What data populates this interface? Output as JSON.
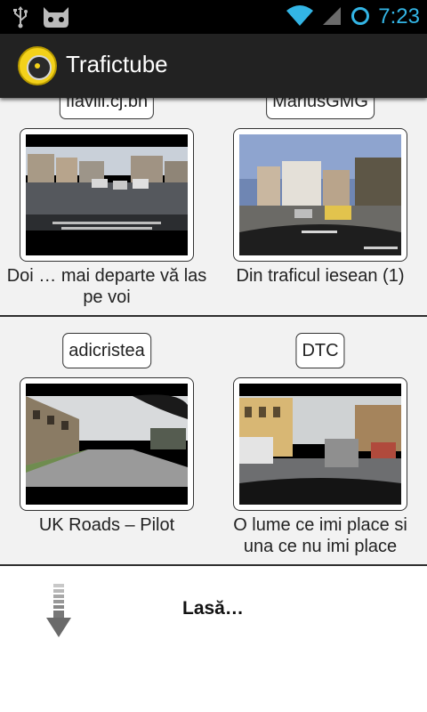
{
  "status_bar": {
    "time": "7:23",
    "icons": [
      "usb-icon",
      "android-debug-icon",
      "wifi-icon",
      "cell-signal-icon",
      "alarm-circle-icon"
    ]
  },
  "app": {
    "title": "Trafictube",
    "icon": "app-logo-icon"
  },
  "videos": [
    {
      "user": "flaviii.cj.bh",
      "title": "Doi … mai departe vă las pe voi"
    },
    {
      "user": "MariusGMG",
      "title": "Din traficul iesean (1)"
    },
    {
      "user": "adicristea",
      "title": "UK Roads – Pilot"
    },
    {
      "user": "DTC",
      "title": "O lume ce imi place si una ce nu imi place"
    }
  ],
  "load_more": {
    "label": "Lasă…",
    "icon": "download-arrow-icon"
  },
  "colors": {
    "accent": "#33b5e5",
    "action_bar": "#222222",
    "list_bg": "#f2f2f2"
  }
}
